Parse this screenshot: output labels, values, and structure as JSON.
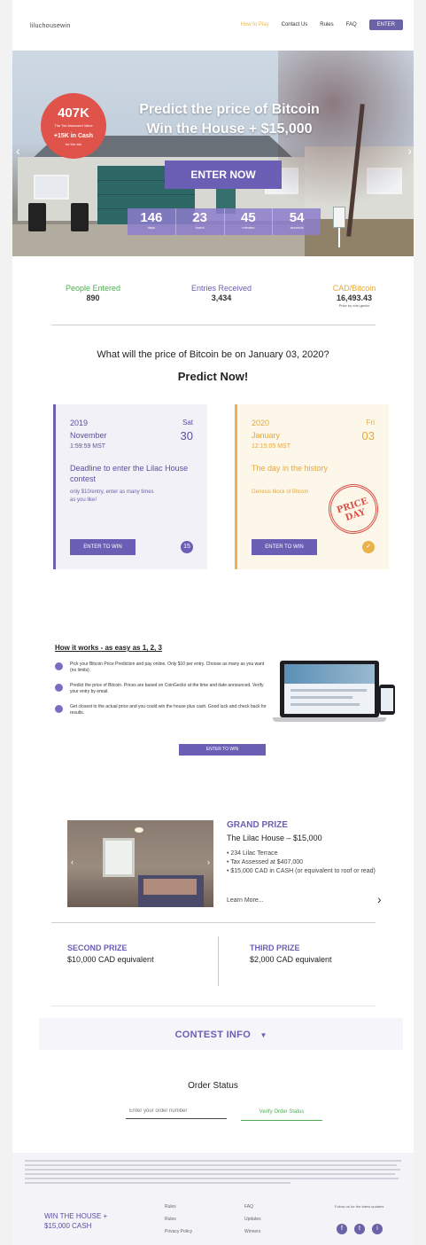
{
  "nav": {
    "brand": "liluchousewin",
    "links": [
      "How to Play",
      "Contact Us",
      "Rules",
      "FAQ"
    ],
    "cta": "ENTER"
  },
  "hero": {
    "badge_value": "407K",
    "badge_sub": "The Tax Assessed Value",
    "badge_cash": "+15K in Cash",
    "badge_note": "for the win",
    "title_line1": "Predict the price of Bitcoin",
    "title_line2": "Win the House + $15,000",
    "enter_label": "ENTER NOW",
    "countdown": [
      {
        "value": "146",
        "unit": "days"
      },
      {
        "value": "23",
        "unit": "hours"
      },
      {
        "value": "45",
        "unit": "minutes"
      },
      {
        "value": "54",
        "unit": "seconds"
      }
    ]
  },
  "stats": {
    "people_label": "People Entered",
    "people_value": "890",
    "entries_label": "Entries Received",
    "entries_value": "3,434",
    "price_label": "CAD/Bitcoin",
    "price_value": "16,493.43",
    "price_note": "Price by coin.gecko"
  },
  "question": "What will the price of Bitcoin be on January 03, 2020?",
  "predict": "Predict Now!",
  "cards": {
    "deadline": {
      "year": "2019",
      "dow": "Sat",
      "month": "November",
      "day": "30",
      "time": "1:59:59 MST",
      "heading": "Deadline to enter the Lilac House contest",
      "body": "only $10/entry, enter as many times as you like!",
      "button": "ENTER TO WIN",
      "icon": "15"
    },
    "history": {
      "year": "2020",
      "dow": "Fri",
      "month": "January",
      "day": "03",
      "time": "12:15:05 MST",
      "heading": "The day in the history",
      "body": "Genesis block of Bitcoin",
      "stamp": "PRICE DAY",
      "button": "ENTER TO WIN",
      "icon": "✓"
    }
  },
  "how": {
    "title": "How it works - as easy as 1, 2, 3",
    "steps": [
      "Pick your Bitcoin Price Prediction and pay online. Only $10 per entry. Choose as many as you want (no limits).",
      "Predict the price of Bitcoin. Prices are based on CoinGecko at the time and date announced. Verify your entry by email.",
      "Get closest to the actual price and you could win the house plus cash. Good luck and check back for results."
    ],
    "button": "ENTER TO WIN"
  },
  "grand_prize": {
    "label": "GRAND PRIZE",
    "title": "The Lilac House – $15,000",
    "items": [
      "• 234 Lilac Terrace",
      "• Tax Assessed at $407,000",
      "• $15,000 CAD in CASH (or equivalent to roof or read)"
    ],
    "more": "Learn More..."
  },
  "second_prize": {
    "label": "SECOND PRIZE",
    "value": "$10,000 CAD equivalent"
  },
  "third_prize": {
    "label": "THIRD PRIZE",
    "value": "$2,000 CAD equivalent"
  },
  "contest_info": "CONTEST INFO",
  "order": {
    "title": "Order Status",
    "placeholder": "Enter your order number",
    "button": "Verify Order Status"
  },
  "footer": {
    "brand": "WIN THE HOUSE + $15,000 CASH",
    "col1": [
      "Rules",
      "Privacy Policy"
    ],
    "col2": [
      "FAQ",
      "Updates",
      "Winners"
    ],
    "col0_top": "Rules",
    "note": "Follow us for the latest updates",
    "social": [
      "f",
      "t",
      "i"
    ]
  }
}
